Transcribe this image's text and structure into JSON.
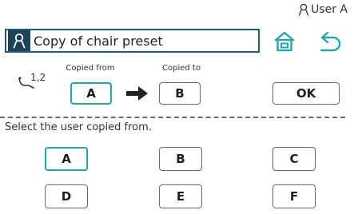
{
  "header": {
    "user_label": "User A",
    "title": "Copy of chair preset",
    "icons": {
      "user": "user-icon",
      "home": "home-icon",
      "back": "back-arrow-icon"
    }
  },
  "copy_row": {
    "chair_icon": "chair-recline-icon",
    "chair_positions": "1,2",
    "copied_from_label": "Copied from",
    "copied_to_label": "Copied to",
    "from_value": "A",
    "to_value": "B",
    "ok_label": "OK"
  },
  "instruction": "Select the user copied from.",
  "users": [
    {
      "label": "A",
      "selected": true
    },
    {
      "label": "B",
      "selected": false
    },
    {
      "label": "C",
      "selected": false
    },
    {
      "label": "D",
      "selected": false
    },
    {
      "label": "E",
      "selected": false
    },
    {
      "label": "F",
      "selected": false
    }
  ],
  "colors": {
    "accent": "#2aa5a7",
    "title_border": "#1d5b78",
    "title_icon_bg": "#1b4256",
    "dashed_line": "#5b6b80"
  }
}
